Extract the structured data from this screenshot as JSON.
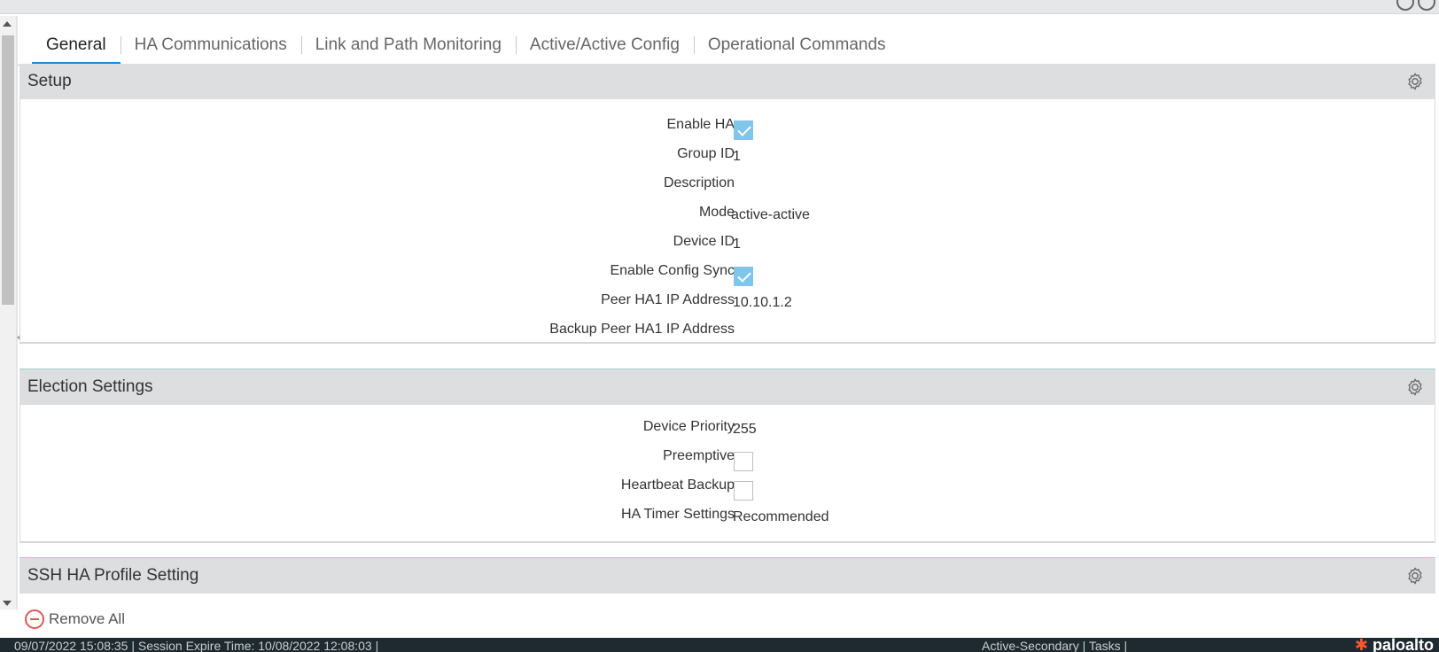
{
  "tabs": [
    {
      "label": "General",
      "active": true
    },
    {
      "label": "HA Communications",
      "active": false
    },
    {
      "label": "Link and Path Monitoring",
      "active": false
    },
    {
      "label": "Active/Active Config",
      "active": false
    },
    {
      "label": "Operational Commands",
      "active": false
    }
  ],
  "setup": {
    "title": "Setup",
    "rows": [
      {
        "label": "Enable HA",
        "type": "checkbox",
        "checked": true
      },
      {
        "label": "Group ID",
        "value": "1"
      },
      {
        "label": "Description",
        "value": ""
      },
      {
        "label": "Mode",
        "value": "active-active"
      },
      {
        "label": "Device ID",
        "value": "1"
      },
      {
        "label": "Enable Config Sync",
        "type": "checkbox",
        "checked": true
      },
      {
        "label": "Peer HA1 IP Address",
        "value": "10.10.1.2"
      },
      {
        "label": "Backup Peer HA1 IP Address",
        "value": ""
      }
    ]
  },
  "election": {
    "title": "Election Settings",
    "rows": [
      {
        "label": "Device Priority",
        "value": "255"
      },
      {
        "label": "Preemptive",
        "type": "checkbox",
        "checked": false
      },
      {
        "label": "Heartbeat Backup",
        "type": "checkbox",
        "checked": false
      },
      {
        "label": "HA Timer Settings",
        "value": "Recommended"
      }
    ]
  },
  "ssh": {
    "title": "SSH HA Profile Setting"
  },
  "footer": {
    "remove_all": "Remove All"
  },
  "statusbar": {
    "left": "09/07/2022 15:08:35 | Session Expire Time: 10/08/2022 12:08:03 |",
    "right": "Active-Secondary | Tasks |",
    "logo": "paloalto"
  },
  "colors": {
    "accent": "#1a8ad6",
    "checkbox_checked": "#7fc6ea",
    "section_header": "#dcdedf",
    "remove_icon": "#e05555"
  },
  "icons": [
    "gear-icon",
    "remove-icon",
    "refresh-icon",
    "help-icon"
  ]
}
